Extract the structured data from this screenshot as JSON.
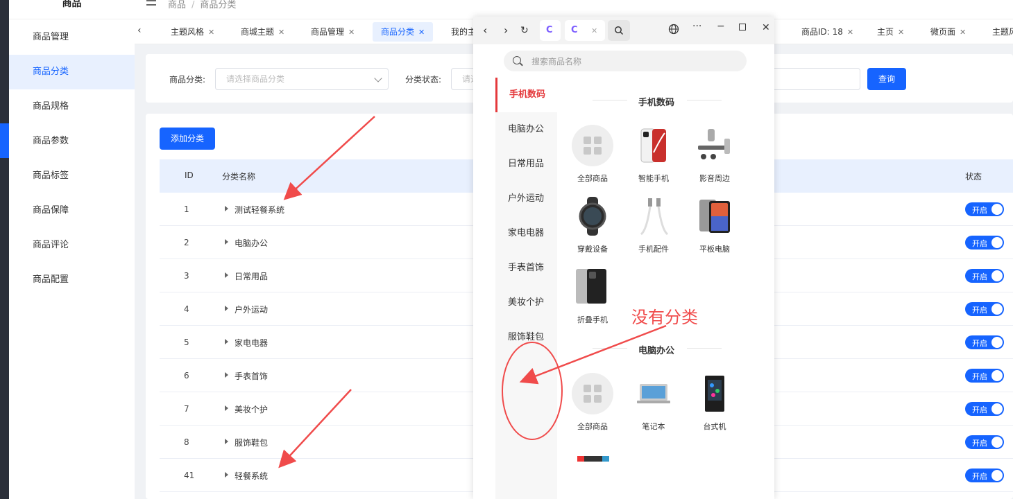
{
  "sidebar": {
    "title": "商品",
    "items": [
      {
        "label": "商品管理",
        "active": false
      },
      {
        "label": "商品分类",
        "active": true
      },
      {
        "label": "商品规格",
        "active": false
      },
      {
        "label": "商品参数",
        "active": false
      },
      {
        "label": "商品标签",
        "active": false
      },
      {
        "label": "商品保障",
        "active": false
      },
      {
        "label": "商品评论",
        "active": false
      },
      {
        "label": "商品配置",
        "active": false
      }
    ]
  },
  "breadcrumb": {
    "root": "商品",
    "separator": "/",
    "current": "商品分类"
  },
  "tabs": [
    {
      "label": "主题风格",
      "active": false
    },
    {
      "label": "商城主题",
      "active": false
    },
    {
      "label": "商品管理",
      "active": false
    },
    {
      "label": "商品分类",
      "active": true
    },
    {
      "label": "我的主",
      "active": false
    },
    {
      "label": "商品ID: 18",
      "active": false
    },
    {
      "label": "主页",
      "active": false
    },
    {
      "label": "微页面",
      "active": false
    },
    {
      "label": "主题风",
      "active": false
    }
  ],
  "filter": {
    "category_label": "商品分类:",
    "category_placeholder": "请选择商品分类",
    "status_label": "分类状态:",
    "status_placeholder": "请选",
    "query_button": "查询"
  },
  "table": {
    "add_button": "添加分类",
    "columns": {
      "id": "ID",
      "name": "分类名称",
      "status": "状态"
    },
    "rows": [
      {
        "id": "1",
        "name": "测试轻餐系统",
        "status": "开启"
      },
      {
        "id": "2",
        "name": "电脑办公",
        "status": "开启"
      },
      {
        "id": "3",
        "name": "日常用品",
        "status": "开启"
      },
      {
        "id": "4",
        "name": "户外运动",
        "status": "开启"
      },
      {
        "id": "5",
        "name": "家电电器",
        "status": "开启"
      },
      {
        "id": "6",
        "name": "手表首饰",
        "status": "开启"
      },
      {
        "id": "7",
        "name": "美妆个护",
        "status": "开启"
      },
      {
        "id": "8",
        "name": "服饰鞋包",
        "status": "开启"
      },
      {
        "id": "41",
        "name": "轻餐系统",
        "status": "开启"
      }
    ]
  },
  "popup": {
    "search_placeholder": "搜索商品名称",
    "categories": [
      {
        "label": "手机数码",
        "active": true
      },
      {
        "label": "电脑办公",
        "active": false
      },
      {
        "label": "日常用品",
        "active": false
      },
      {
        "label": "户外运动",
        "active": false
      },
      {
        "label": "家电电器",
        "active": false
      },
      {
        "label": "手表首饰",
        "active": false
      },
      {
        "label": "美妆个护",
        "active": false
      },
      {
        "label": "服饰鞋包",
        "active": false
      }
    ],
    "sections": [
      {
        "title": "手机数码",
        "items": [
          {
            "label": "全部商品",
            "icon": "grid-icon"
          },
          {
            "label": "智能手机",
            "icon": "smartphone-icon"
          },
          {
            "label": "影音周边",
            "icon": "speaker-icon"
          },
          {
            "label": "穿戴设备",
            "icon": "smartwatch-icon"
          },
          {
            "label": "手机配件",
            "icon": "cable-icon"
          },
          {
            "label": "平板电脑",
            "icon": "tablet-icon"
          },
          {
            "label": "折叠手机",
            "icon": "foldable-phone-icon"
          }
        ]
      },
      {
        "title": "电脑办公",
        "items": [
          {
            "label": "全部商品",
            "icon": "grid-icon"
          },
          {
            "label": "笔记本",
            "icon": "laptop-icon"
          },
          {
            "label": "台式机",
            "icon": "desktop-tower-icon"
          }
        ]
      }
    ]
  },
  "annotation": {
    "text": "没有分类",
    "color": "#f04b4b"
  },
  "colors": {
    "primary": "#1664ff",
    "active_category": "#e4393c",
    "annotation": "#f04b4b"
  }
}
